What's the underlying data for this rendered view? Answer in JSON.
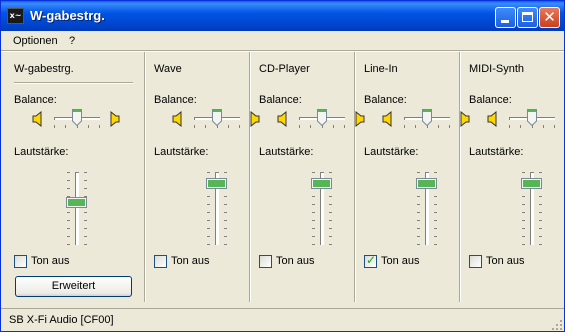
{
  "window": {
    "title": "W-gabestrg.",
    "icon": "mixer-app-icon"
  },
  "menu": [
    {
      "label": "Optionen"
    },
    {
      "label": "?"
    }
  ],
  "labels": {
    "balance": "Balance:",
    "volume": "Lautstärke:",
    "mute": "Ton aus",
    "advanced": "Erweitert"
  },
  "channels": [
    {
      "name": "W-gabestrg.",
      "balance": 0.5,
      "volume": 0.6,
      "muted": false,
      "has_advanced": true
    },
    {
      "name": "Wave",
      "balance": 0.5,
      "volume": 0.9,
      "muted": false
    },
    {
      "name": "CD-Player",
      "balance": 0.5,
      "volume": 0.9,
      "muted": false
    },
    {
      "name": "Line-In",
      "balance": 0.5,
      "volume": 0.9,
      "muted": true
    },
    {
      "name": "MIDI-Synth",
      "balance": 0.5,
      "volume": 0.9,
      "muted": false
    }
  ],
  "status": {
    "device": "SB X-Fi Audio [CF00]"
  },
  "colors": {
    "title_bar": "#0055e5",
    "window_bg": "#ece9d8",
    "thumb_accent": "#21a121",
    "speaker": "#ffd700"
  }
}
